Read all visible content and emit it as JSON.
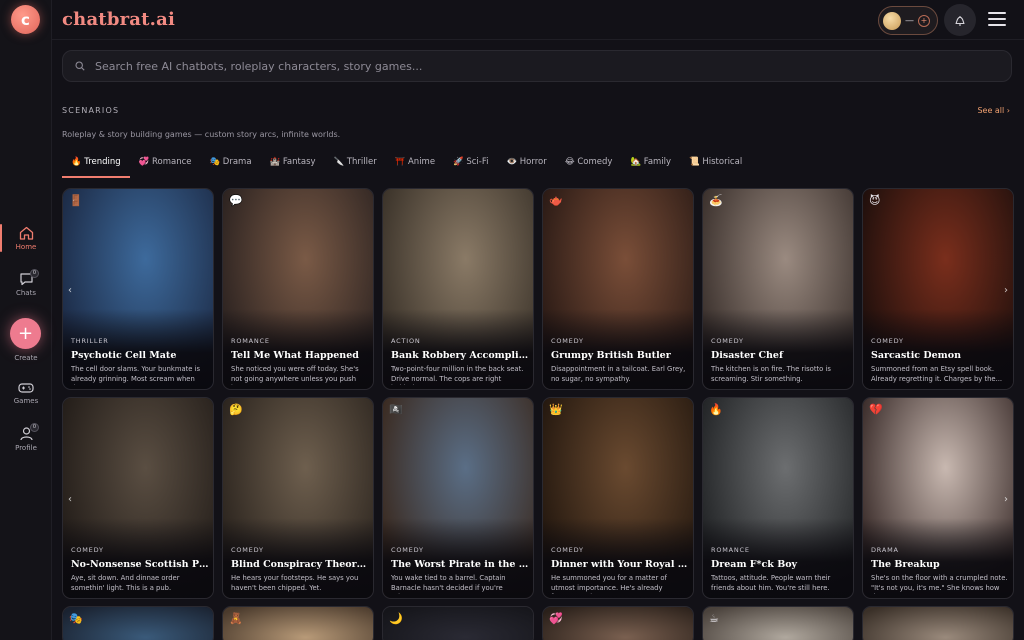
{
  "app": {
    "logo_letter": "c",
    "brand": "chatbrat.ai"
  },
  "header": {
    "coin_count": "—",
    "coin_plus": "+"
  },
  "sidebar": {
    "items": [
      {
        "label": "Home",
        "icon": "home-icon"
      },
      {
        "label": "Chats",
        "icon": "chat-icon",
        "badge": "0"
      },
      {
        "label": "Create",
        "icon": "plus-icon"
      },
      {
        "label": "Games",
        "icon": "gamepad-icon"
      },
      {
        "label": "Profile",
        "icon": "user-icon",
        "badge": "0"
      }
    ]
  },
  "search": {
    "placeholder": "Search free AI chatbots, roleplay characters, story games..."
  },
  "section": {
    "title": "SCENARIOS",
    "see_all": "See all ›",
    "subtitle": "Roleplay & story building games — custom story arcs, infinite worlds."
  },
  "tabs": [
    {
      "label": "🔥 Trending"
    },
    {
      "label": "💞 Romance"
    },
    {
      "label": "🎭 Drama"
    },
    {
      "label": "🏰 Fantasy"
    },
    {
      "label": "🔪 Thriller"
    },
    {
      "label": "⛩️ Anime"
    },
    {
      "label": "🚀 Sci-Fi"
    },
    {
      "label": "👁️ Horror"
    },
    {
      "label": "😂 Comedy"
    },
    {
      "label": "🏡 Family"
    },
    {
      "label": "📜 Historical"
    }
  ],
  "cards": [
    {
      "emoji": "🚪",
      "genre": "THRILLER",
      "title": "Psychotic Cell Mate",
      "desc": "The cell door slams. Your bunkmate is already grinning. Most scream when the...",
      "colors": [
        "#3d6a9c",
        "#1c2a45"
      ]
    },
    {
      "emoji": "💬",
      "genre": "ROMANCE",
      "title": "Tell Me What Happened",
      "desc": "She noticed you were off today. She's not going anywhere unless you push her...",
      "colors": [
        "#7a5a46",
        "#2b2220"
      ]
    },
    {
      "emoji": "",
      "genre": "ACTION",
      "title": "Bank Robbery Accomplice",
      "desc": "Two-point-four million in the back seat. Drive normal. The cops are right behind...",
      "colors": [
        "#8a7a66",
        "#3a3229"
      ]
    },
    {
      "emoji": "🫖",
      "genre": "COMEDY",
      "title": "Grumpy British Butler",
      "desc": "Disappointment in a tailcoat. Earl Grey, no sugar, no sympathy.",
      "colors": [
        "#7a4e38",
        "#2a1a15"
      ]
    },
    {
      "emoji": "🍝",
      "genre": "COMEDY",
      "title": "Disaster Chef",
      "desc": "The kitchen is on fire. The risotto is screaming. Stir something.",
      "colors": [
        "#9a8a80",
        "#3a302c"
      ]
    },
    {
      "emoji": "😈",
      "genre": "COMEDY",
      "title": "Sarcastic Demon",
      "desc": "Summoned from an Etsy spell book. Already regretting it. Charges by the...",
      "colors": [
        "#7a2e1c",
        "#1e0f0c"
      ]
    },
    {
      "emoji": "",
      "genre": "COMEDY",
      "title": "No-Nonsense Scottish Pub Ow...",
      "desc": "Aye, sit down. And dinnae order somethin' light. This is a pub.",
      "colors": [
        "#5a4e42",
        "#231d19"
      ]
    },
    {
      "emoji": "🤔",
      "genre": "COMEDY",
      "title": "Blind Conspiracy Theorist",
      "desc": "He hears your footsteps. He says you haven't been chipped. Yet.",
      "colors": [
        "#6e5f4e",
        "#2b241e"
      ]
    },
    {
      "emoji": "🏴‍☠️",
      "genre": "COMEDY",
      "title": "The Worst Pirate in the Caribb...",
      "desc": "You wake tied to a barrel. Captain Barnacle hasn't decided if you're prisone...",
      "colors": [
        "#5a6e86",
        "#3a2a20"
      ]
    },
    {
      "emoji": "👑",
      "genre": "COMEDY",
      "title": "Dinner with Your Royal Highn...",
      "desc": "He summoned you for a matter of utmost importance. He's already forgotten what...",
      "colors": [
        "#6a4a30",
        "#24180f"
      ]
    },
    {
      "emoji": "🔥",
      "genre": "ROMANCE",
      "title": "Dream F*ck Boy",
      "desc": "Tattoos, attitude. People warn their friends about him. You're still here.",
      "colors": [
        "#6c6e70",
        "#222426"
      ]
    },
    {
      "emoji": "💔",
      "genre": "DRAMA",
      "title": "The Breakup",
      "desc": "She's on the floor with a crumpled note. \"It's not you, it's me.\" She knows how tha...",
      "colors": [
        "#c8b8b0",
        "#3a2c2a"
      ]
    }
  ],
  "partial_cards": [
    {
      "emoji": "🎭",
      "colors": [
        "#3a5a7a",
        "#1a2230"
      ]
    },
    {
      "emoji": "🧸",
      "colors": [
        "#b89a78",
        "#4a3a2c"
      ]
    },
    {
      "emoji": "🌙",
      "colors": [
        "#2a2a34",
        "#15151a"
      ]
    },
    {
      "emoji": "💞",
      "colors": [
        "#7a6050",
        "#2a201a"
      ]
    },
    {
      "emoji": "☕",
      "colors": [
        "#b0a89e",
        "#4a423c"
      ]
    },
    {
      "emoji": "",
      "colors": [
        "#9a8a7c",
        "#3a3028"
      ]
    }
  ],
  "accent": "#f07d6f"
}
